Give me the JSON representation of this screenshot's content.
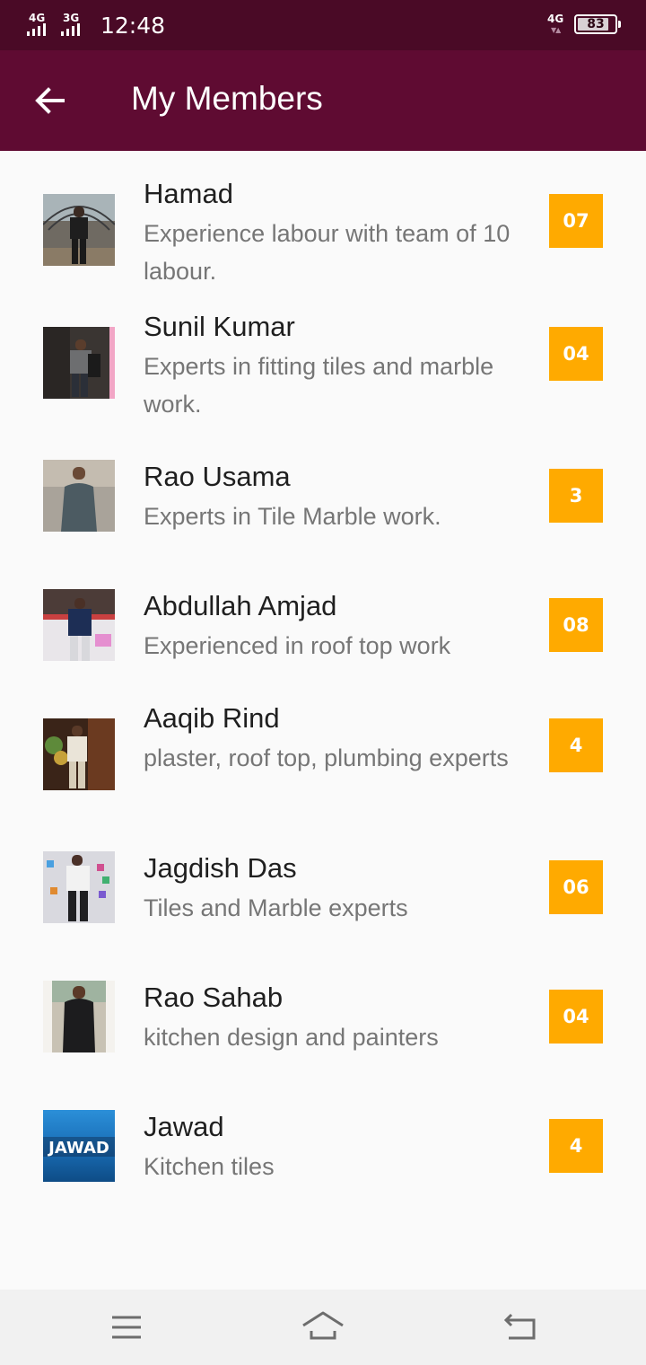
{
  "status": {
    "network1": "4G",
    "network2": "3G",
    "time": "12:48",
    "network_right": "4G",
    "battery": "83"
  },
  "header": {
    "title": "My Members"
  },
  "icons": {
    "back": "arrow-left-icon",
    "menu": "menu-icon",
    "home": "home-icon",
    "back_nav": "back-icon"
  },
  "colors": {
    "status_bar": "#4a0a26",
    "app_bar": "#5f0b32",
    "badge": "#ffaa00"
  },
  "members": [
    {
      "name": "Hamad",
      "desc": "Experience labour with team of 10 labour.",
      "count": "07"
    },
    {
      "name": "Sunil Kumar",
      "desc": "Experts in fitting tiles and marble work.",
      "count": "04"
    },
    {
      "name": "Rao Usama",
      "desc": "Experts in Tile Marble work.",
      "count": "3"
    },
    {
      "name": "Abdullah Amjad",
      "desc": "Experienced in roof top work",
      "count": "08"
    },
    {
      "name": "Aaqib Rind",
      "desc": "plaster, roof top, plumbing experts",
      "count": "4"
    },
    {
      "name": "Jagdish Das",
      "desc": "Tiles and Marble experts",
      "count": "06"
    },
    {
      "name": "Rao Sahab",
      "desc": "kitchen design and painters",
      "count": "04"
    },
    {
      "name": "Jawad",
      "desc": "Kitchen tiles",
      "count": "4",
      "avatar_text": "JAWAD"
    }
  ]
}
